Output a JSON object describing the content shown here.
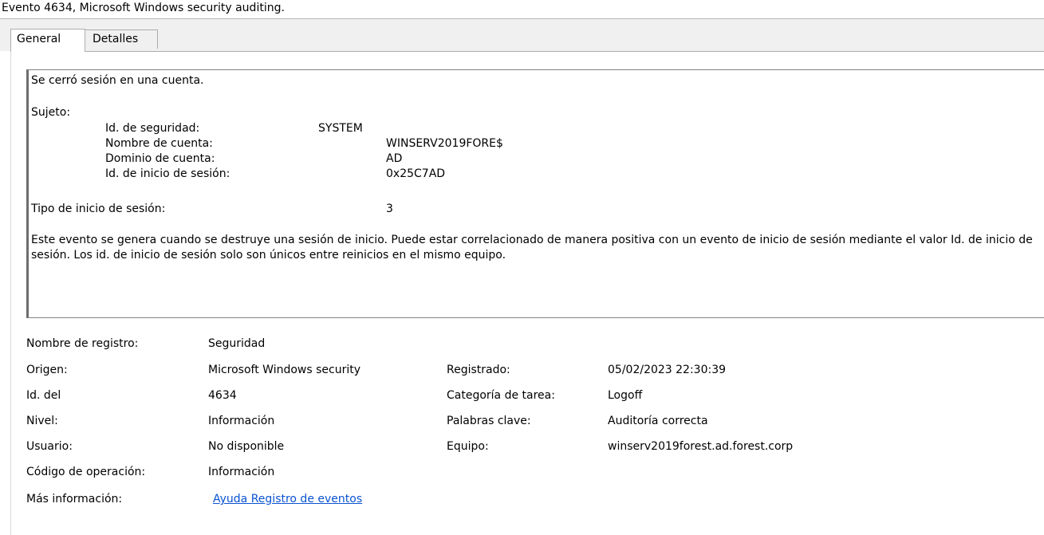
{
  "window": {
    "title": "Evento 4634, Microsoft Windows security auditing."
  },
  "tabs": [
    {
      "label": "General",
      "active": true
    },
    {
      "label": "Detalles",
      "active": false
    }
  ],
  "description": {
    "headline": "Se cerró sesión en una cuenta.",
    "subject_label": "Sujeto:",
    "subject_fields": [
      {
        "label": "Id. de seguridad:",
        "value": "SYSTEM"
      },
      {
        "label": "Nombre de cuenta:",
        "value": "WINSERV2019FORE$"
      },
      {
        "label": "Dominio de cuenta:",
        "value": "AD"
      },
      {
        "label": "Id. de inicio de sesión:",
        "value": "0x25C7AD"
      }
    ],
    "logon_type_label": "Tipo de inicio de sesión:",
    "logon_type_value": "3",
    "paragraph": "Este evento se genera cuando se destruye una sesión de inicio. Puede estar correlacionado de manera positiva con un evento de inicio de sesión mediante el valor Id. de inicio de sesión. Los id. de inicio de sesión solo son únicos entre reinicios en el mismo equipo."
  },
  "details": {
    "log_name_label": "Nombre de registro:",
    "log_name_value": "Seguridad",
    "source_label": "Origen:",
    "source_value": "Microsoft Windows security",
    "logged_label": "Registrado:",
    "logged_value": "05/02/2023 22:30:39",
    "event_id_label": "Id. del",
    "event_id_value": "4634",
    "task_category_label": "Categoría de tarea:",
    "task_category_value": "Logoff",
    "level_label": "Nivel:",
    "level_value": "Información",
    "keywords_label": "Palabras clave:",
    "keywords_value": "Auditoría correcta",
    "user_label": "Usuario:",
    "user_value": "No disponible",
    "computer_label": "Equipo:",
    "computer_value": "winserv2019forest.ad.forest.corp",
    "opcode_label": "Código de operación:",
    "opcode_value": "Información",
    "more_info_label": "Más información:",
    "more_info_link": "Ayuda Registro de eventos"
  }
}
